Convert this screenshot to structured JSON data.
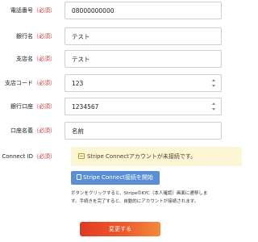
{
  "required_mark": "（必須）",
  "fields": [
    {
      "label": "電話番号",
      "value": "08000000000"
    },
    {
      "label": "銀行名",
      "value": "テスト"
    },
    {
      "label": "支店名",
      "value": "テスト"
    },
    {
      "label": "支店コード",
      "value": "123"
    },
    {
      "label": "銀行口座",
      "value": "1234567"
    },
    {
      "label": "口座名義",
      "value": "名前"
    }
  ],
  "stripe": {
    "label": "Stripe Connect ID",
    "notice": "Stripe Connectアカウントが未接続です。",
    "notice_icon": "warning-card-icon",
    "connect_button": "Stripe Connect接続を開始",
    "connect_button_icon": "document-icon",
    "help_line1": "ボタンをクリックすると、StripeのKYC（本人確認）画面に遷移しま",
    "help_line2": "す。手続きを完了すると、自動的にアカウントが接続されます。"
  },
  "submit_button": "変更する",
  "colors": {
    "required": "#d93a3a",
    "notice_bg": "#fdf6d4",
    "connect_button": "#5a8fd6",
    "submit_start": "#e03a22",
    "submit_end": "#f08a3c"
  }
}
